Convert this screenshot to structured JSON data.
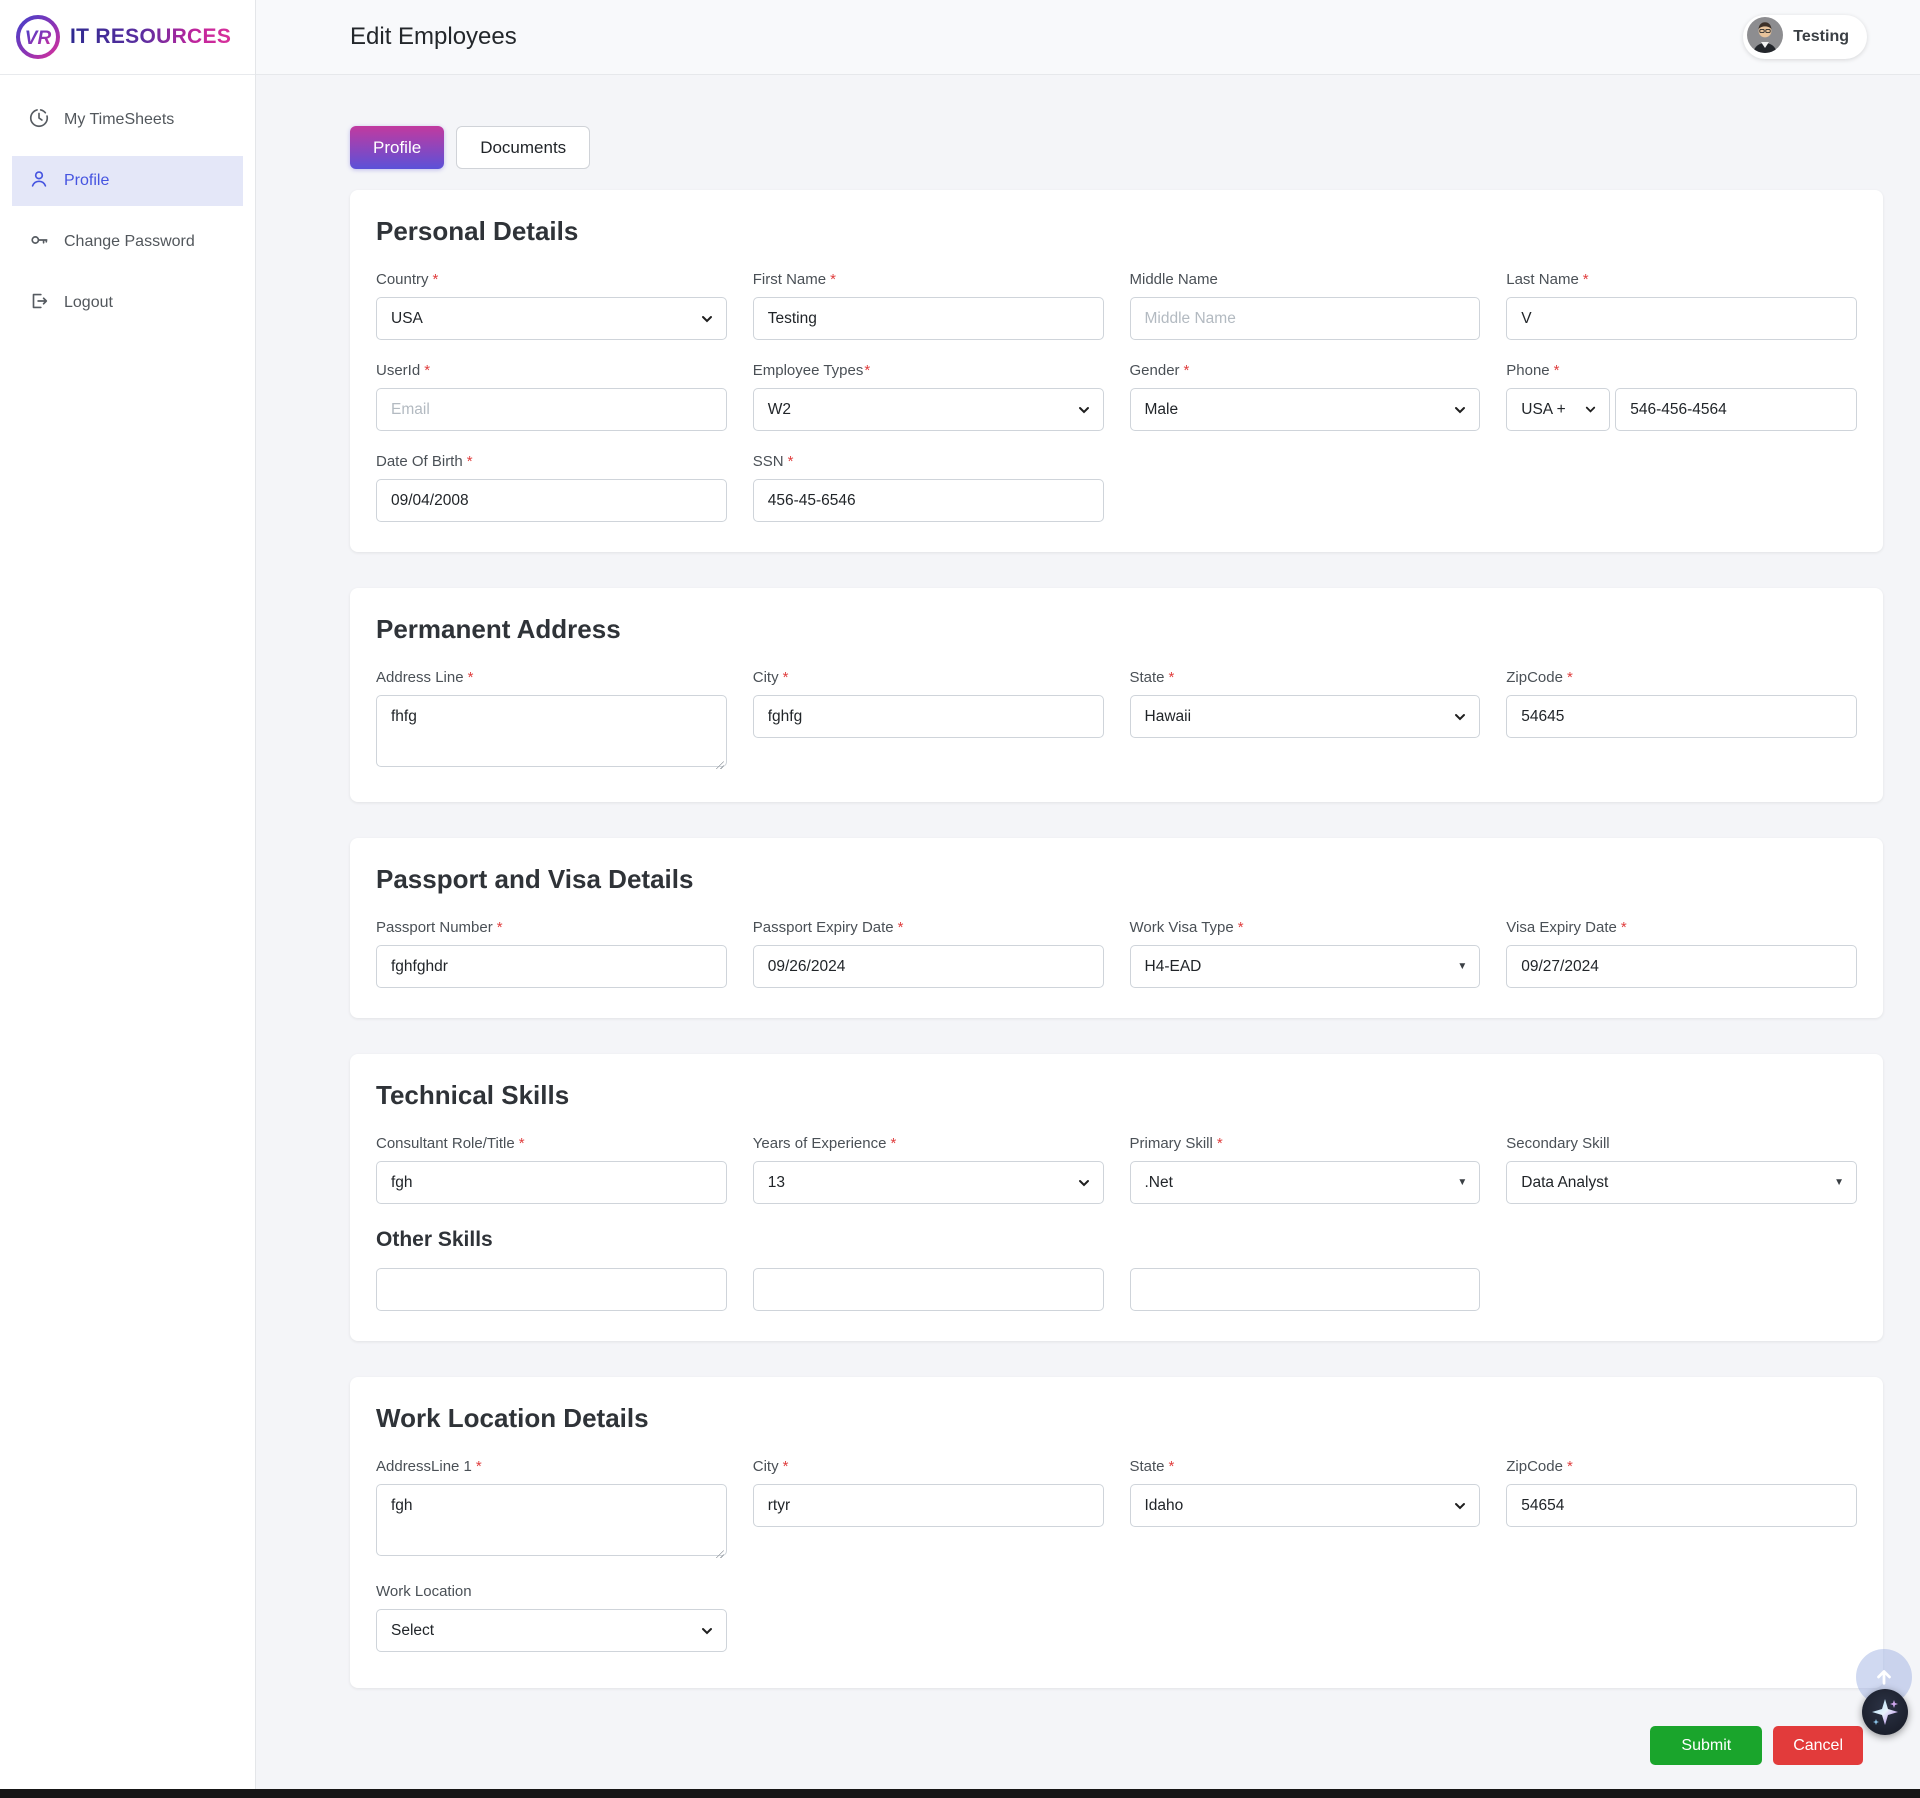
{
  "ui": {
    "required_marker": "*"
  },
  "brand": {
    "name": "IT RESOURCES",
    "monogram": "VR"
  },
  "header": {
    "title": "Edit Employees",
    "user": "Testing"
  },
  "sidebar": {
    "items": [
      {
        "label": "My TimeSheets",
        "icon": "clock-icon",
        "active": false
      },
      {
        "label": "Profile",
        "icon": "user-icon",
        "active": true
      },
      {
        "label": "Change Password",
        "icon": "key-icon",
        "active": false
      },
      {
        "label": "Logout",
        "icon": "logout-icon",
        "active": false
      }
    ]
  },
  "tabs": {
    "profile": "Profile",
    "documents": "Documents"
  },
  "personal": {
    "title": "Personal Details",
    "country": {
      "label": "Country",
      "value": "USA"
    },
    "first_name": {
      "label": "First Name",
      "value": "Testing"
    },
    "middle_name": {
      "label": "Middle Name",
      "placeholder": "Middle Name"
    },
    "last_name": {
      "label": "Last Name",
      "value": "V"
    },
    "user_id": {
      "label": "UserId",
      "placeholder": "Email"
    },
    "employee_types": {
      "label": "Employee Types",
      "value": "W2"
    },
    "gender": {
      "label": "Gender",
      "value": "Male"
    },
    "phone": {
      "label": "Phone",
      "code": "USA +",
      "value": "546-456-4564"
    },
    "dob": {
      "label": "Date Of Birth",
      "value": "09/04/2008"
    },
    "ssn": {
      "label": "SSN",
      "value": "456-45-6546"
    }
  },
  "permanent_address": {
    "title": "Permanent Address",
    "address_line": {
      "label": "Address Line",
      "value": "fhfg"
    },
    "city": {
      "label": "City",
      "value": "fghfg"
    },
    "state": {
      "label": "State",
      "value": "Hawaii"
    },
    "zipcode": {
      "label": "ZipCode",
      "value": "54645"
    }
  },
  "passport_visa": {
    "title": "Passport and Visa Details",
    "passport_number": {
      "label": "Passport Number",
      "value": "fghfghdr"
    },
    "passport_expiry": {
      "label": "Passport Expiry Date",
      "value": "09/26/2024"
    },
    "work_visa_type": {
      "label": "Work Visa Type",
      "value": "H4-EAD"
    },
    "visa_expiry": {
      "label": "Visa Expiry Date",
      "value": "09/27/2024"
    }
  },
  "technical_skills": {
    "title": "Technical Skills",
    "consultant_role": {
      "label": "Consultant Role/Title",
      "value": "fgh"
    },
    "years_experience": {
      "label": "Years of Experience",
      "value": "13"
    },
    "primary_skill": {
      "label": "Primary Skill",
      "value": ".Net"
    },
    "secondary_skill": {
      "label": "Secondary Skill",
      "value": "Data Analyst"
    },
    "other_skills_title": "Other Skills"
  },
  "work_location": {
    "title": "Work Location Details",
    "address_line1": {
      "label": "AddressLine 1",
      "value": "fgh"
    },
    "city": {
      "label": "City",
      "value": "rtyr"
    },
    "state": {
      "label": "State",
      "value": "Idaho"
    },
    "zipcode": {
      "label": "ZipCode",
      "value": "54654"
    },
    "work_location": {
      "label": "Work Location",
      "value": "Select"
    }
  },
  "actions": {
    "submit": "Submit",
    "cancel": "Cancel"
  },
  "colors": {
    "tab_gradient_start": "#c23a9f",
    "tab_gradient_end": "#5b51d8",
    "sidebar_active_bg": "#e4e7f8",
    "sidebar_active_text": "#4554e0",
    "submit_green": "#1aa52c",
    "cancel_red": "#e23b3b",
    "required_red": "#e03e3e",
    "content_bg": "#f4f5f8"
  }
}
